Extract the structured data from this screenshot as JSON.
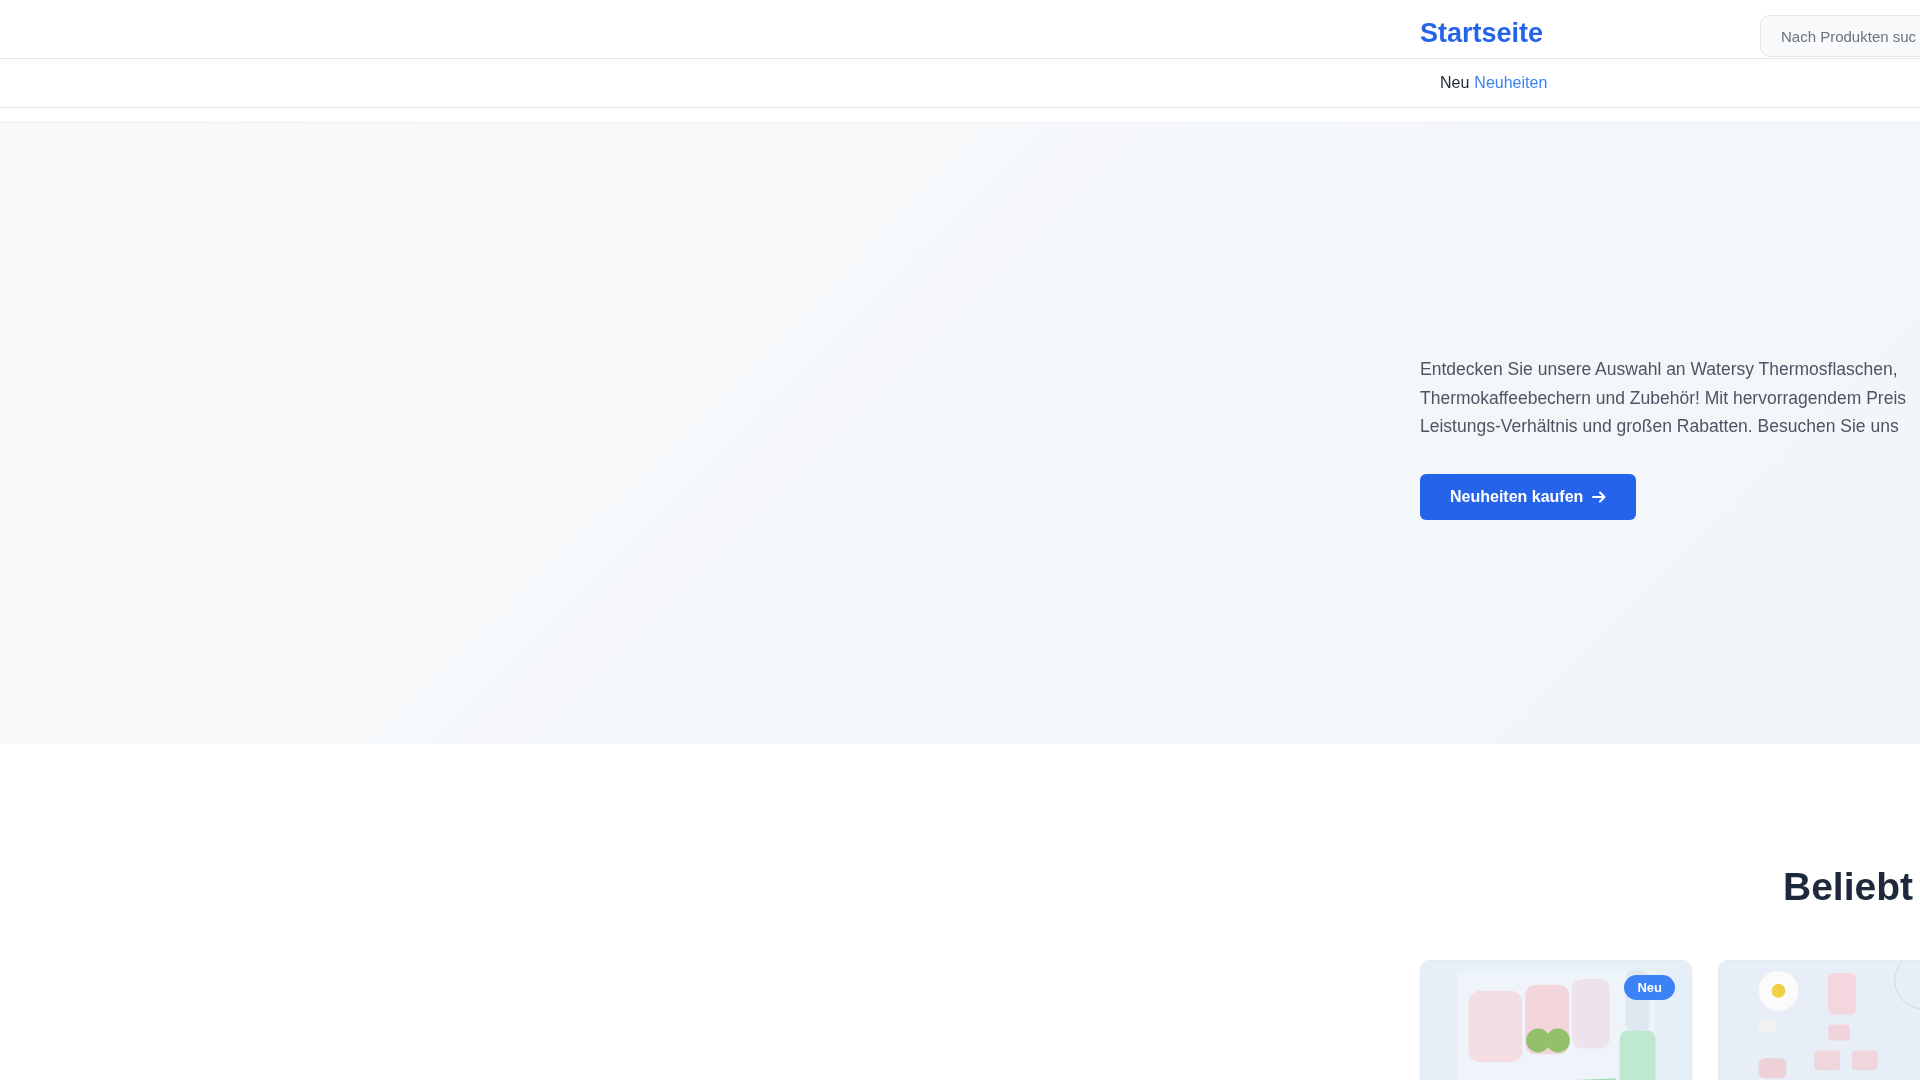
{
  "header": {
    "logo": "Startseite",
    "search": {
      "placeholder": "Nach Produkten suc"
    }
  },
  "breadcrumb": {
    "current": "Neu",
    "link": "Neuheiten"
  },
  "hero": {
    "text": "Entdecken Sie unsere Auswahl an Watersy Thermosflaschen,\nThermokaffeebechern und Zubehör! Mit hervorragendem Preis\nLeistungs-Verhältnis und großen Rabatten. Besuchen Sie uns",
    "button": "Neuheiten kaufen"
  },
  "section": {
    "title": "Beliebt",
    "products": [
      {
        "kind": "picture",
        "badge": "Neu"
      },
      {
        "kind": "picture"
      }
    ]
  }
}
